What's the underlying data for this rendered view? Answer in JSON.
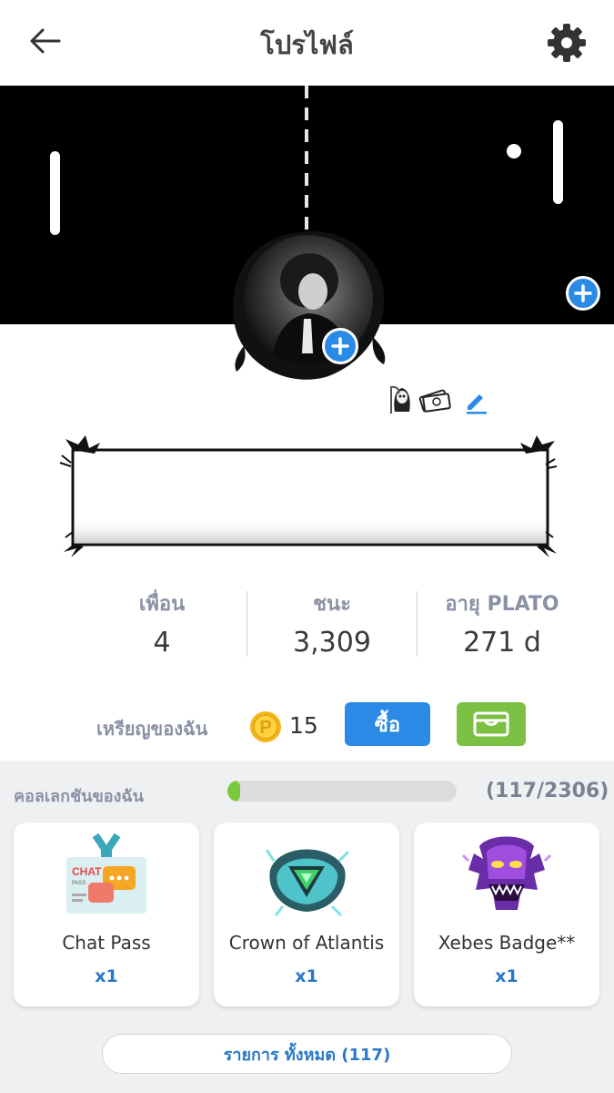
{
  "header": {
    "title": "โปรไฟล์",
    "back_icon": "arrow-left-icon",
    "settings_icon": "gear-icon"
  },
  "banner": {
    "theme": "pong",
    "add_icon": "plus-icon"
  },
  "avatar": {
    "add_icon": "plus-icon"
  },
  "badges": [
    "grim-reaper-icon",
    "money-stack-icon"
  ],
  "stats": [
    {
      "label": "เพื่อน",
      "value": "4"
    },
    {
      "label": "ชนะ",
      "value": "3,309"
    },
    {
      "label": "อายุ PLATO",
      "value": "271 d"
    }
  ],
  "coins": {
    "label": "เหรียญของฉัน",
    "count": "15",
    "buy_label": "ซื้อ",
    "coin_icon": "plato-coin-icon",
    "wallet_icon": "wallet-icon"
  },
  "collection": {
    "title": "คอลเลกชันของฉัน",
    "progress_text": "(117/2306)",
    "progress": 0.0507,
    "items": [
      {
        "name": "Chat Pass",
        "qty": "x1",
        "icon": "chat-pass-icon"
      },
      {
        "name": "Crown of Atlantis",
        "qty": "x1",
        "icon": "crown-of-atlantis-icon"
      },
      {
        "name": "Xebes Badge**",
        "qty": "x1",
        "icon": "xebes-badge-icon"
      }
    ],
    "all_button": "รายการ ทั้งหมด (117)"
  },
  "colors": {
    "accent_blue": "#2a8ae6",
    "wallet_green": "#7bc043",
    "progress_green": "#7ac93c",
    "label_gray": "#8a91a6"
  }
}
